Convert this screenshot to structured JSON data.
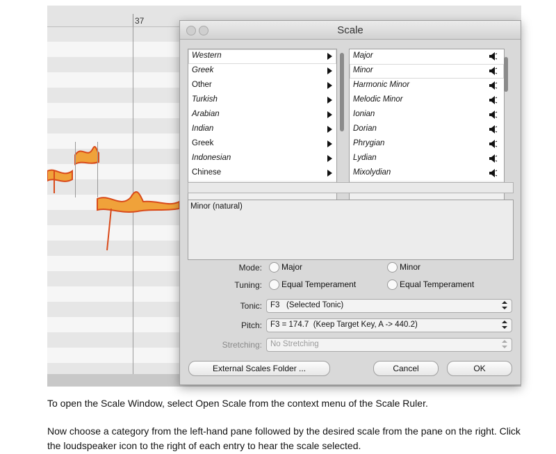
{
  "ruler": {
    "bar_number": "37"
  },
  "dialog": {
    "title": "Scale",
    "categories": [
      {
        "label": "Western",
        "italic": true
      },
      {
        "label": "Greek",
        "italic": true
      },
      {
        "label": "Other",
        "italic": false
      },
      {
        "label": "Turkish",
        "italic": true
      },
      {
        "label": "Arabian",
        "italic": true
      },
      {
        "label": "Indian",
        "italic": true
      },
      {
        "label": "Greek",
        "italic": false
      },
      {
        "label": "Indonesian",
        "italic": true
      },
      {
        "label": "Chinese",
        "italic": false
      }
    ],
    "scales": [
      "Major",
      "Minor",
      "Harmonic Minor",
      "Melodic Minor",
      "Ionian",
      "Dorian",
      "Phrygian",
      "Lydian",
      "Mixolydian"
    ],
    "selected_scale_index": 1,
    "description": "Minor (natural)",
    "mode": {
      "label": "Mode:",
      "option_a": "Major",
      "option_b": "Minor"
    },
    "tuning": {
      "label": "Tuning:",
      "option_a": "Equal Temperament",
      "option_b": "Equal Temperament"
    },
    "tonic": {
      "label": "Tonic:",
      "value": "F3   (Selected Tonic)"
    },
    "pitch": {
      "label": "Pitch:",
      "value": "F3 = 174.7  (Keep Target Key, A -> 440.2)"
    },
    "stretching": {
      "label": "Stretching:",
      "value": "No Stretching"
    },
    "buttons": {
      "folder": "External Scales Folder ...",
      "cancel": "Cancel",
      "ok": "OK"
    }
  },
  "caption": {
    "line1": "To open the Scale Window, select Open Scale from the context menu of the Scale Ruler.",
    "line2": "Now choose a category from the left-hand pane followed by the desired scale from the pane on the right. Click the loudspeaker icon to the right of each entry to hear the scale selected."
  },
  "colors": {
    "note_blob": "#d94a1a",
    "note_fill": "#f0a23a",
    "selection": "#ffffff",
    "dialog_bg": "#d9d9d9"
  }
}
